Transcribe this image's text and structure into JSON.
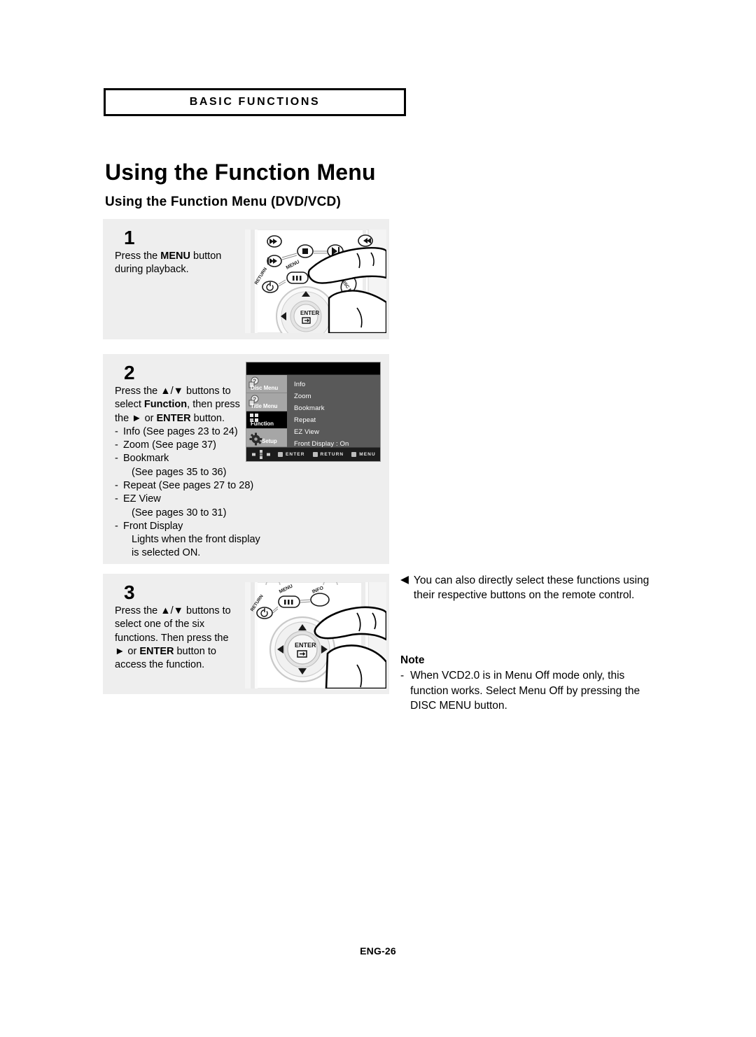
{
  "chapter": {
    "label": "BASIC FUNCTIONS"
  },
  "title": "Using the Function Menu",
  "subtitle": "Using the Function Menu (DVD/VCD)",
  "steps": [
    {
      "number": "1",
      "lines": [
        "Press the MENU button",
        "during playback."
      ],
      "illustration": "remote-menu-button-press"
    },
    {
      "number": "2",
      "lines": [
        "Press the ▲/▼ buttons to",
        "select Function, then press",
        "the ▶ or ENTER button."
      ],
      "bullets": [
        {
          "dash": "-",
          "text": "Info (See pages 23 to 24)"
        },
        {
          "dash": "-",
          "text": "Zoom (See page 37)"
        },
        {
          "dash": "-",
          "text": "Bookmark"
        },
        {
          "dash": "",
          "text": "(See pages 35 to 36)",
          "indent": true
        },
        {
          "dash": "-",
          "text": "Repeat (See pages 27 to 28)"
        },
        {
          "dash": "-",
          "text": "EZ View"
        },
        {
          "dash": "",
          "text": "(See pages 30 to 31)",
          "indent": true
        },
        {
          "dash": "-",
          "text": "Front Display"
        },
        {
          "dash": "",
          "text": "Lights when the front display",
          "indent": true
        },
        {
          "dash": "",
          "text": "is selected ON.",
          "indent": true
        }
      ],
      "illustration": "osd-function-menu"
    },
    {
      "number": "3",
      "lines": [
        "Press the ▲/▼ buttons to",
        "select one of the six",
        "functions. Then press the",
        "▶ or ENTER button to",
        "access the function."
      ],
      "illustration": "remote-enter-button-press"
    }
  ],
  "osd": {
    "sidebar": [
      {
        "label": "Disc Menu",
        "icon": "disc-question-icon",
        "active": false
      },
      {
        "label": "Title Menu",
        "icon": "title-question-icon",
        "active": false
      },
      {
        "label": "Function",
        "icon": "function-grid-icon",
        "active": true
      },
      {
        "label": "Setup",
        "icon": "gear-icon",
        "active": false
      }
    ],
    "items": [
      "Info",
      "Zoom",
      "Bookmark",
      "Repeat",
      "EZ View",
      "Front Display : On"
    ],
    "footer_hints": [
      "ENTER",
      "RETURN",
      "MENU"
    ],
    "colors": {
      "panel": "#595959",
      "sidebar": "#a6a6a6",
      "active": "#000000",
      "text": "#ffffff",
      "footer": "#1c1c1c"
    }
  },
  "remote_labels": {
    "menu": "MENU",
    "return": "RETURN",
    "disc_menu": "DISC MENU",
    "info": "INFO",
    "enter": "ENTER"
  },
  "right_note": {
    "glyph": "◀",
    "lines": [
      "You can also directly select these functions",
      "using their respective buttons on the remote",
      "control."
    ]
  },
  "note": {
    "title": "Note",
    "dash": "-",
    "lines": [
      "When VCD2.0 is in Menu Off mode only, this",
      "function works. Select Menu Off by pressing the",
      "DISC MENU button."
    ]
  },
  "footer": {
    "page_label": "ENG-26"
  }
}
